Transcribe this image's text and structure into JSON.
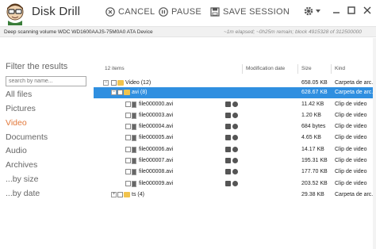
{
  "app": {
    "title": "Disk Drill"
  },
  "toolbar": {
    "cancel": "CANCEL",
    "pause": "PAUSE",
    "save": "SAVE SESSION"
  },
  "status": {
    "left": "Deep scanning volume WDC WD1600AAJS-75M0A0 ATA Device",
    "right": "~1m elapsed; ~0h25m remain; block 4915328 of 312500000"
  },
  "sidebar": {
    "title": "Filter the results",
    "search_placeholder": "search by name...",
    "items": [
      {
        "label": "All files",
        "active": false
      },
      {
        "label": "Pictures",
        "active": false
      },
      {
        "label": "Video",
        "active": true
      },
      {
        "label": "Documents",
        "active": false
      },
      {
        "label": "Audio",
        "active": false
      },
      {
        "label": "Archives",
        "active": false
      },
      {
        "label": "...by size",
        "active": false
      },
      {
        "label": "...by date",
        "active": false
      }
    ],
    "active_color": "#e2783a"
  },
  "list": {
    "count": "12 items",
    "columns": [
      "Modification date",
      "Size",
      "Kind"
    ],
    "selection_color": "#2f8fe0",
    "rows": [
      {
        "name": "Video (12)",
        "size": "658.05 KB",
        "kind": "Carpeta de arc...",
        "type": "folder",
        "expander": "−",
        "selected": false
      },
      {
        "name": "avi (8)",
        "size": "628.67 KB",
        "kind": "Carpeta de arc...",
        "type": "folder",
        "expander": "−",
        "selected": true
      },
      {
        "name": "file000000.avi",
        "size": "11.42 KB",
        "kind": "Clip de video",
        "type": "file",
        "selected": false
      },
      {
        "name": "file000003.avi",
        "size": "1.20 KB",
        "kind": "Clip de video",
        "type": "file",
        "selected": false
      },
      {
        "name": "file000004.avi",
        "size": "684 bytes",
        "kind": "Clip de video",
        "type": "file",
        "selected": false
      },
      {
        "name": "file000005.avi",
        "size": "4.65 KB",
        "kind": "Clip de video",
        "type": "file",
        "selected": false
      },
      {
        "name": "file000006.avi",
        "size": "14.17 KB",
        "kind": "Clip de video",
        "type": "file",
        "selected": false
      },
      {
        "name": "file000007.avi",
        "size": "195.31 KB",
        "kind": "Clip de video",
        "type": "file",
        "selected": false
      },
      {
        "name": "file000008.avi",
        "size": "177.70 KB",
        "kind": "Clip de video",
        "type": "file",
        "selected": false
      },
      {
        "name": "file000009.avi",
        "size": "203.52 KB",
        "kind": "Clip de video",
        "type": "file",
        "selected": false
      },
      {
        "name": "ts (4)",
        "size": "29.38 KB",
        "kind": "Carpeta de arc...",
        "type": "folder",
        "expander": "+",
        "selected": false
      }
    ]
  }
}
